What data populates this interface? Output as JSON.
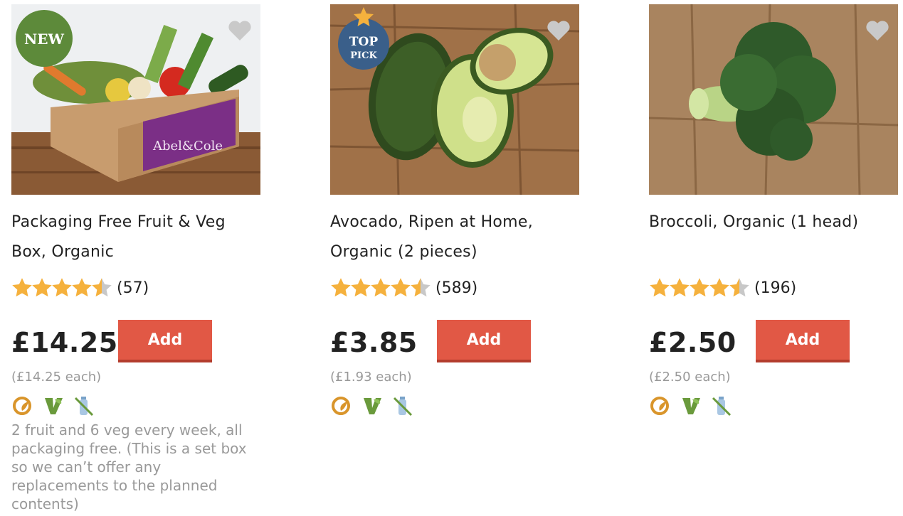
{
  "products": [
    {
      "title": "Packaging Free Fruit & Veg Box, Organic",
      "badge": "NEW",
      "rating": 4.5,
      "review_count": "(57)",
      "price": "£14.25",
      "add_label": "Add",
      "unit_price": "(£14.25 each)",
      "description": "2 fruit and 6 veg every week, all packaging free. (This is a set box so we can’t offer any replacements to the planned contents)",
      "box_text": "Abel&Cole"
    },
    {
      "title": "Avocado, Ripen at Home, Organic (2 pieces)",
      "badge_line1": "TOP",
      "badge_line2": "PICK",
      "rating": 4.5,
      "review_count": "(589)",
      "price": "£3.85",
      "add_label": "Add",
      "unit_price": "(£1.93 each)"
    },
    {
      "title": "Broccoli, Organic (1 head)",
      "rating": 4.5,
      "review_count": "(196)",
      "price": "£2.50",
      "add_label": "Add",
      "unit_price": "(£2.50 each)"
    }
  ],
  "colors": {
    "accent": "#e15845",
    "star": "#f5b13d",
    "star_empty": "#c8c8c8",
    "muted": "#999999",
    "badge_new": "#5d8a3a",
    "badge_top": "#3a5f8a"
  },
  "icons": [
    "organic-icon",
    "vegan-icon",
    "plastic-free-icon"
  ]
}
